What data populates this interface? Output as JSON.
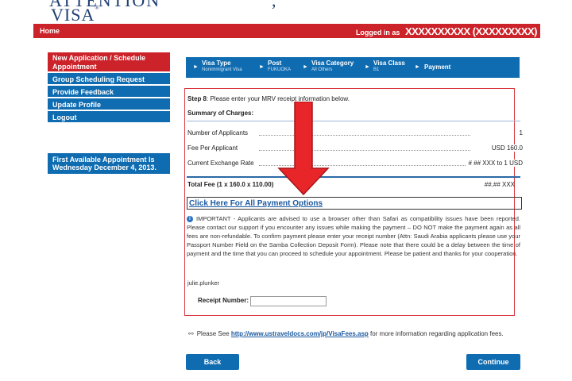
{
  "header": {
    "brand": "VISA",
    "home_label": "Home",
    "logged_in_label": "Logged in as",
    "username_masked": "XXXXXXXXXX (XXXXXXXXX)"
  },
  "sidebar": {
    "items": [
      {
        "label": "New Application / Schedule Appointment",
        "active": true
      },
      {
        "label": "Group Scheduling Request"
      },
      {
        "label": "Provide Feedback"
      },
      {
        "label": "Update Profile"
      },
      {
        "label": "Logout"
      }
    ],
    "appointment_notice": "First Available Appointment Is Wednesday December 4, 2013."
  },
  "steps": [
    {
      "title": "Visa Type",
      "sub": "Nonimmigrant Visa"
    },
    {
      "title": "Post",
      "sub": "FUKUOKA"
    },
    {
      "title": "Visa Category",
      "sub": "All Others"
    },
    {
      "title": "Visa Class",
      "sub": "B1"
    },
    {
      "title": "Payment",
      "sub": ""
    }
  ],
  "main": {
    "step_prefix": "Step 8",
    "step_text": ": Please enter your MRV receipt information below.",
    "charges_title": "Summary of Charges:",
    "rows": [
      {
        "label": "Number of Applicants",
        "value": "1"
      },
      {
        "label": "Fee Per Applicant",
        "value": "USD 160.0"
      },
      {
        "label": "Current Exchange Rate",
        "value": "# ## XXX    to 1 USD"
      }
    ],
    "total_label": "Total Fee (1 x 160.0 x 110.00)",
    "total_value": "##.## XXX",
    "payment_link": "Click Here For All Payment Options",
    "important": "IMPORTANT - Applicants are advised to use a browser other than Safari as compatibility issues have been reported. Please contact our support if you encounter any issues while making the payment – DO NOT make the payment again as all fees are non-refundable. To confirm payment please enter your receipt number (Attn: Saudi Arabia applicants please use your Passport Number Field on the Samba Collection Deposit Form). Please note that there could be a delay between the time of payment and the time that you can proceed to schedule your appointment. Please be patient and thanks for your cooperation.",
    "account_user": "julie.plunker",
    "receipt_label": "Receipt Number:",
    "receipt_value": ""
  },
  "footer": {
    "note_prefix": "Please See",
    "note_link": "http://www.ustraveldocs.com/jp/VisaFees.asp",
    "note_suffix": "for more information regarding application fees.",
    "back_label": "Back",
    "continue_label": "Continue"
  },
  "colors": {
    "accent_blue": "#0f6cb1",
    "accent_red": "#cc2229",
    "annotation_red": "#e8262a"
  }
}
